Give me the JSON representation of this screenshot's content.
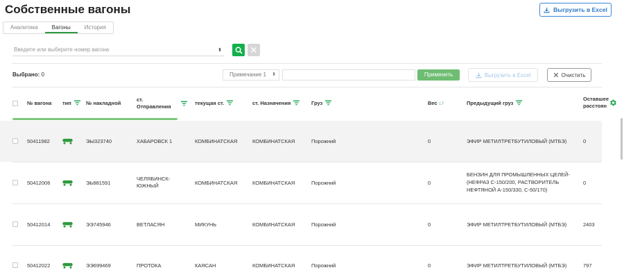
{
  "page": {
    "title": "Собственные вагоны",
    "export_top_label": "Выгрузить в Excel"
  },
  "tabs": [
    {
      "label": "Аналитика",
      "active": false
    },
    {
      "label": "Вагоны",
      "active": true
    },
    {
      "label": "История",
      "active": false
    }
  ],
  "search": {
    "placeholder": "Введите или выберите номер вагона"
  },
  "toolbar": {
    "selected_label": "Выбрано:",
    "selected_count": "0",
    "note_select_value": "Примечание 1",
    "note_input_value": "",
    "apply_label": "Применить",
    "export_label": "Выгрузить в Excel",
    "clear_label": "Очистить"
  },
  "colors": {
    "accent_green": "#12b04a",
    "accent_blue": "#2a78c8"
  },
  "table": {
    "columns": [
      {
        "key": "num",
        "label": "№ вагона"
      },
      {
        "key": "type",
        "label": "тип"
      },
      {
        "key": "invoice",
        "label": "№ накладной"
      },
      {
        "key": "from_a",
        "label": "ст."
      },
      {
        "key": "from_b",
        "label": "Отправления"
      },
      {
        "key": "current",
        "label": "текущая ст."
      },
      {
        "key": "dest",
        "label": "ст. Назначения"
      },
      {
        "key": "cargo",
        "label": "Груз"
      },
      {
        "key": "weight",
        "label": "Вес"
      },
      {
        "key": "prev",
        "label": "Предыдущий груз"
      },
      {
        "key": "rem_a",
        "label": "Оставшее"
      },
      {
        "key": "rem_b",
        "label": "расстоян"
      }
    ],
    "rows": [
      {
        "num": "50411982",
        "invoice": "ЭЫ323740",
        "from": "ХАБАРОВСК 1",
        "current": "КОМБИНАТСКАЯ",
        "dest": "КОМБИНАТСКАЯ",
        "cargo": "Порожний",
        "weight": "0",
        "prev": "ЭФИР МЕТИЛТРЕТБУТИЛОВЫЙ (МТБЭ)",
        "remaining": "0"
      },
      {
        "num": "50412006",
        "invoice": "ЭЬ881591",
        "from": "ЧЕЛЯБИНСК-\nЮЖНЫЙ",
        "current": "КОМБИНАТСКАЯ",
        "dest": "КОМБИНАТСКАЯ",
        "cargo": "Порожний",
        "weight": "0",
        "prev": "БЕНЗИН ДЛЯ ПРОМЫШЛЕННЫХ ЦЕЛЕЙ-\n(НЕФРАЗ С-150/200, РАСТВОРИТЕЛЬ\nНЕФТЯНОЙ А-150/330, С-50/170)",
        "remaining": "0"
      },
      {
        "num": "50412014",
        "invoice": "ЭЭ745946",
        "from": "ВЕТЛАСЯН",
        "current": "МИКУНЬ",
        "dest": "КОМБИНАТСКАЯ",
        "cargo": "Порожний",
        "weight": "0",
        "prev": "ЭФИР МЕТИЛТРЕТБУТИЛОВЫЙ (МТБЭ)",
        "remaining": "2403"
      },
      {
        "num": "50412022",
        "invoice": "ЭЭ699469",
        "from": "ПРОТОКА",
        "current": "КАЯСАН",
        "dest": "КОМБИНАТСКАЯ",
        "cargo": "Порожний",
        "weight": "0",
        "prev": "ЭФИР МЕТИЛТРЕТБУТИЛОВЫЙ (МТБЭ)",
        "remaining": "797"
      }
    ]
  }
}
